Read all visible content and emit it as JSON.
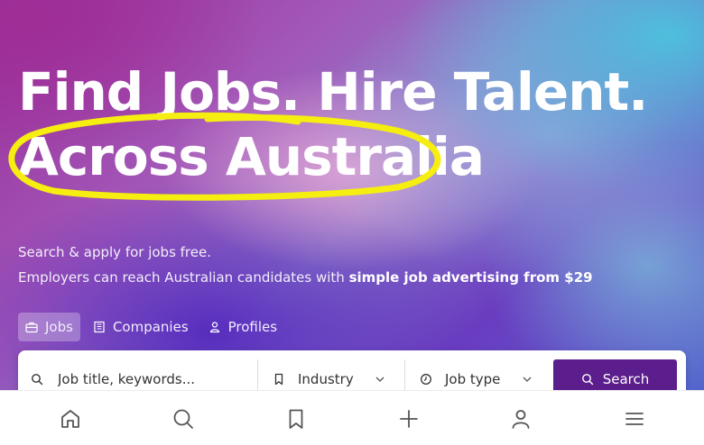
{
  "hero": {
    "headline_line1": "Find Jobs. Hire Talent.",
    "headline_line2": "Across Australia",
    "subtitle_line1": "Search & apply for jobs free.",
    "subtitle_line2_prefix": "Employers can reach Australian candidates with ",
    "subtitle_line2_highlight": "simple job advertising from $29",
    "highlight_circle_color": "#f5ee10"
  },
  "tabs": [
    {
      "label": "Jobs",
      "icon": "briefcase-icon",
      "active": true
    },
    {
      "label": "Companies",
      "icon": "building-icon",
      "active": false
    },
    {
      "label": "Profiles",
      "icon": "person-icon",
      "active": false
    }
  ],
  "search": {
    "keywords_placeholder": "Job title, keywords...",
    "industry_label": "Industry",
    "jobtype_label": "Job type",
    "button_label": "Search",
    "button_color": "#5b1e8c"
  },
  "bottom_nav": [
    {
      "icon": "home-icon"
    },
    {
      "icon": "search-icon"
    },
    {
      "icon": "bookmark-icon"
    },
    {
      "icon": "plus-icon"
    },
    {
      "icon": "profile-icon"
    },
    {
      "icon": "menu-icon"
    }
  ]
}
